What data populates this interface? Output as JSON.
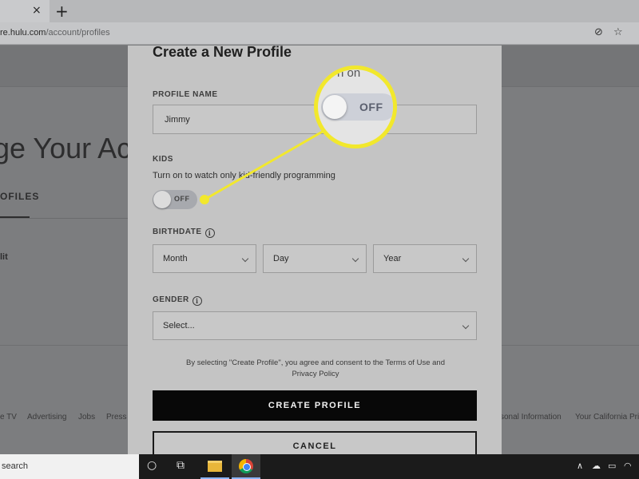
{
  "browser": {
    "tab_close": "×",
    "new_tab": "+",
    "url_host": "re.hulu.com",
    "url_path": "/account/profiles",
    "icons": [
      "site-permission-icon",
      "bookmark-star-icon"
    ]
  },
  "background_page": {
    "title": "ge Your Ac",
    "tab": "OFILES",
    "item": "lit",
    "footer_links": [
      "e TV",
      "Advertising",
      "Jobs",
      "Press",
      "sonal Information",
      "Your California Priv"
    ]
  },
  "modal": {
    "title": "Create a New Profile",
    "profile_name_label": "PROFILE NAME",
    "profile_name_value": "Jimmy",
    "kids_label": "KIDS",
    "kids_description": "Turn on to watch only kid-friendly programming",
    "kids_toggle_state": "OFF",
    "birthdate_label": "BIRTHDATE",
    "birthdate_info": "i",
    "month_value": "Month",
    "day_value": "Day",
    "year_value": "Year",
    "gender_label": "GENDER",
    "gender_info": "i",
    "gender_value": "Select...",
    "consent_prefix": "By selecting \"Create Profile\", you agree and consent to the ",
    "consent_terms": "Terms of Use",
    "consent_and": " and ",
    "consent_privacy": "Privacy Policy",
    "create_button": "CREATE PROFILE",
    "cancel_button": "CANCEL"
  },
  "callout": {
    "background_text": "n on",
    "toggle_state": "OFF",
    "color": "#f2e82c"
  },
  "taskbar": {
    "search_text": "search",
    "apps": [
      "cortana-icon",
      "task-view-icon",
      "file-explorer-icon",
      "chrome-icon"
    ],
    "tray": [
      "chevron-up-icon",
      "onedrive-icon",
      "battery-icon",
      "wifi-icon"
    ]
  }
}
